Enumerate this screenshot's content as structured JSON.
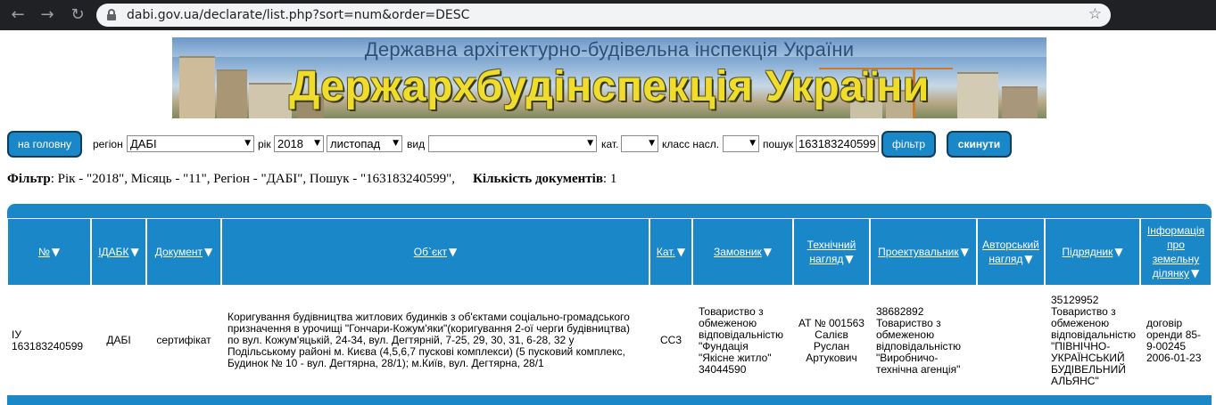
{
  "browser": {
    "url": "dabi.gov.ua/declarate/list.php?sort=num&order=DESC"
  },
  "banner": {
    "subtitle": "Державна архітектурно-будівельна інспекція України",
    "title": "Держархбудінспекція України"
  },
  "filters": {
    "home_button": "на головну",
    "region_label": "регіон",
    "region_value": "ДАБІ",
    "year_label": "рік",
    "year_value": "2018",
    "month_value": "листопад",
    "kind_label": "вид",
    "kind_value": "",
    "category_label": "кат.",
    "category_value": "",
    "class_label": "класс насл.",
    "class_value": "",
    "search_label": "пошук",
    "search_value": "163183240599",
    "filter_button": "фільтр",
    "reset_button": "скинути"
  },
  "summary": {
    "filter_label": "Фільтр",
    "filter_text": ": Рік - \"2018\", Місяць - \"11\", Регіон - \"ДАБІ\", Пошук - \"163183240599\",",
    "count_label": "Кількість документів",
    "count_text": ": 1"
  },
  "table": {
    "headers": {
      "num": "№",
      "idabk": "ІДАБК",
      "document": "Документ",
      "object": "Об`єкт",
      "cat": "Кат.",
      "customer": "Замовник",
      "tech_line1": "Технічний",
      "tech_line2": "нагляд",
      "designer": "Проектувальник",
      "author_line1": "Авторський",
      "author_line2": "нагляд",
      "contractor": "Підрядник",
      "land_line1": "Інформація",
      "land_line2": "про",
      "land_line3": "земельну",
      "land_line4": "ділянку"
    },
    "row": {
      "num": "ІУ 163183240599",
      "idabk": "ДАБІ",
      "document": "сертифікат",
      "object": "Коригування будівництва житлових будинків з об'єктами соціально-громадського призначення в урочищі \"Гончари-Кожум'яки\"(коригування 2-ої черги будівництва) по вул. Кожум'яцькій, 24-34, вул. Дегтярній, 7-25, 29, 30, 31, 6-28, 32 у Подільському районі м. Києва (4,5,6,7 пускові комплекси) (5 пусковий комплекс, Будинок № 10 - вул. Дегтярна, 28/1); м.Київ, вул. Дегтярна, 28/1",
      "cat": "СС3",
      "customer": "Товариство з обмеженою відповідальністю \"Фундація \"Якісне житло\" 34044590",
      "tech": "АТ № 001563 Салієв Руслан Артукович",
      "designer": "38682892 Товариство з обмеженою відповідальністю \"Виробничо-технічна агенція\"",
      "author": "",
      "contractor": "35129952 Товариство з обмеженою відповідальністю \"ПІВНІЧНО-УКРАЇНСЬКИЙ БУДІВЕЛЬНИЙ АЛЬЯНС\"",
      "land": "договір оренди 85-9-00245 2006-01-23"
    }
  },
  "colors": {
    "accent": "#1a87c9",
    "browser_bar": "#202124"
  }
}
